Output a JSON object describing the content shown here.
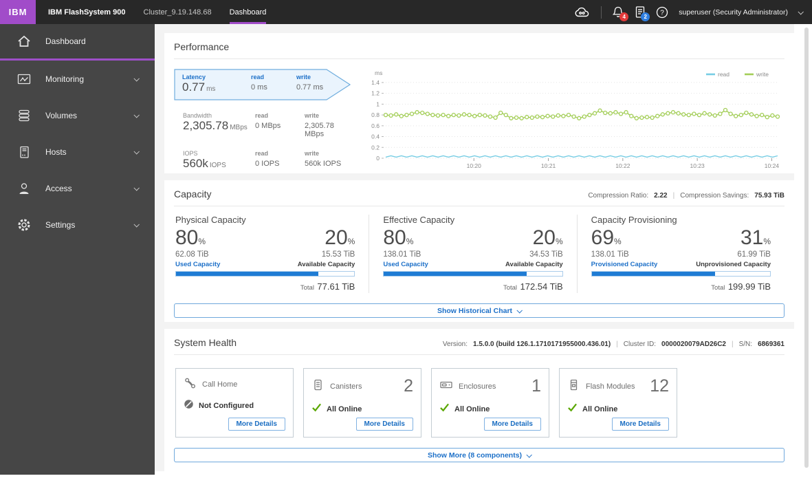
{
  "topbar": {
    "logo": "IBM",
    "product": "IBM FlashSystem 900",
    "cluster": "Cluster_9.19.148.68",
    "active_tab": "Dashboard",
    "alerts_badge": "4",
    "tasks_badge": "2",
    "help_glyph": "?",
    "user": "superuser (Security Administrator)"
  },
  "sidebar": {
    "items": [
      {
        "label": "Dashboard"
      },
      {
        "label": "Monitoring"
      },
      {
        "label": "Volumes"
      },
      {
        "label": "Hosts"
      },
      {
        "label": "Access"
      },
      {
        "label": "Settings"
      }
    ]
  },
  "performance": {
    "title": "Performance",
    "metrics": [
      {
        "name": "Latency",
        "value": "0.77",
        "unit": "ms",
        "read_label": "read",
        "read_value": "0 ms",
        "write_label": "write",
        "write_value": "0.77 ms"
      },
      {
        "name": "Bandwidth",
        "value": "2,305.78",
        "unit": "MBps",
        "read_label": "read",
        "read_value": "0 MBps",
        "write_label": "write",
        "write_value": "2,305.78 MBps"
      },
      {
        "name": "IOPS",
        "value": "560k",
        "unit": "IOPS",
        "read_label": "read",
        "read_value": "0 IOPS",
        "write_label": "write",
        "write_value": "560k IOPS"
      }
    ]
  },
  "chart_data": {
    "type": "line",
    "title": "",
    "xlabel": "",
    "ylabel": "ms",
    "ylim": [
      0,
      1.45
    ],
    "yticks": [
      0,
      0.2,
      0.4,
      0.6,
      0.8,
      1,
      1.2,
      1.4
    ],
    "xticklabels": [
      "10:20",
      "10:21",
      "10:22",
      "10:23",
      "10:24"
    ],
    "xtick_fractions": [
      0.225,
      0.415,
      0.605,
      0.795,
      0.985
    ],
    "grid": true,
    "legend_position": "top-right",
    "series": [
      {
        "name": "read",
        "color": "#76cde4",
        "markers": false,
        "values": [
          0.02,
          0.045,
          0.02,
          0.045,
          0.02,
          0.045,
          0.02,
          0.045,
          0.02,
          0.045,
          0.02,
          0.045,
          0.02,
          0.045,
          0.02,
          0.045,
          0.02,
          0.045,
          0.02,
          0.045,
          0.02,
          0.045,
          0.02,
          0.045,
          0.02,
          0.045,
          0.02,
          0.045,
          0.02,
          0.045,
          0.02,
          0.045,
          0.02,
          0.045,
          0.02,
          0.045,
          0.02,
          0.045,
          0.02,
          0.045,
          0.02,
          0.045,
          0.02,
          0.045,
          0.02,
          0.045,
          0.02,
          0.045,
          0.02,
          0.045,
          0.02,
          0.045,
          0.02,
          0.045,
          0.02,
          0.045,
          0.02,
          0.045,
          0.02,
          0.045,
          0.02,
          0.045,
          0.02,
          0.045,
          0.02,
          0.045,
          0.02,
          0.045,
          0.02,
          0.045,
          0.02,
          0.045,
          0.02,
          0.045,
          0.02,
          0.045
        ]
      },
      {
        "name": "write",
        "color": "#a3ce57",
        "markers": true,
        "values": [
          0.8,
          0.79,
          0.81,
          0.78,
          0.8,
          0.82,
          0.85,
          0.84,
          0.82,
          0.8,
          0.79,
          0.8,
          0.78,
          0.8,
          0.79,
          0.81,
          0.8,
          0.78,
          0.8,
          0.79,
          0.77,
          0.75,
          0.84,
          0.8,
          0.74,
          0.75,
          0.74,
          0.76,
          0.75,
          0.77,
          0.76,
          0.78,
          0.77,
          0.79,
          0.78,
          0.8,
          0.77,
          0.74,
          0.77,
          0.8,
          0.83,
          0.88,
          0.84,
          0.83,
          0.85,
          0.82,
          0.85,
          0.78,
          0.74,
          0.75,
          0.76,
          0.75,
          0.78,
          0.81,
          0.83,
          0.85,
          0.83,
          0.81,
          0.8,
          0.82,
          0.8,
          0.83,
          0.81,
          0.79,
          0.82,
          0.89,
          0.82,
          0.78,
          0.8,
          0.84,
          0.81,
          0.78,
          0.8,
          0.76,
          0.79,
          0.77
        ]
      }
    ]
  },
  "capacity": {
    "title": "Capacity",
    "percent_symbol": "%",
    "compression_ratio_label": "Compression Ratio:",
    "compression_ratio": "2.22",
    "compression_savings_label": "Compression Savings:",
    "compression_savings": "75.93 TiB",
    "panels": [
      {
        "title": "Physical Capacity",
        "left_pct": "80",
        "right_pct": "20",
        "left_amount": "62.08 TiB",
        "right_amount": "15.53 TiB",
        "left_label": "Used Capacity",
        "right_label": "Available Capacity",
        "fill": 80,
        "total_label": "Total",
        "total_value": "77.61 TiB"
      },
      {
        "title": "Effective Capacity",
        "left_pct": "80",
        "right_pct": "20",
        "left_amount": "138.01 TiB",
        "right_amount": "34.53 TiB",
        "left_label": "Used Capacity",
        "right_label": "Available Capacity",
        "fill": 80,
        "total_label": "Total",
        "total_value": "172.54 TiB"
      },
      {
        "title": "Capacity Provisioning",
        "left_pct": "69",
        "right_pct": "31",
        "left_amount": "138.01 TiB",
        "right_amount": "61.99 TiB",
        "left_label": "Provisioned Capacity",
        "right_label": "Unprovisioned Capacity",
        "fill": 69,
        "total_label": "Total",
        "total_value": "199.99 TiB"
      }
    ],
    "show_chart_button": "Show Historical Chart"
  },
  "system_health": {
    "title": "System Health",
    "version_label": "Version:",
    "version": "1.5.0.0 (build 126.1.1710171955000.436.01)",
    "cluster_id_label": "Cluster ID:",
    "cluster_id": "0000020079AD26C2",
    "serial_label": "S/N:",
    "serial": "6869361",
    "cards": [
      {
        "name": "Call Home",
        "count": "",
        "status": "Not Configured",
        "button": "More Details"
      },
      {
        "name": "Canisters",
        "count": "2",
        "status": "All Online",
        "button": "More Details"
      },
      {
        "name": "Enclosures",
        "count": "1",
        "status": "All Online",
        "button": "More Details"
      },
      {
        "name": "Flash Modules",
        "count": "12",
        "status": "All Online",
        "button": "More Details"
      }
    ],
    "show_more_button": "Show More (8 components)"
  },
  "colors": {
    "accent_blue": "#1d70c8",
    "bar_fill_blue": "#1f7cd4",
    "brand_purple": "#a14cc9",
    "status_green": "#5aa700",
    "chart_read": "#76cde4",
    "chart_write": "#a3ce57"
  }
}
